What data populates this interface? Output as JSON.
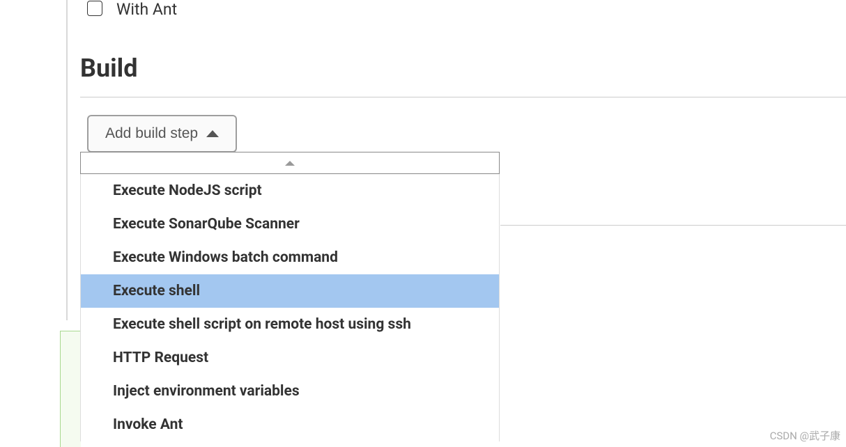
{
  "withAnt": {
    "label": "With Ant",
    "checked": false
  },
  "buildSection": {
    "title": "Build",
    "addBuildStepLabel": "Add build step"
  },
  "dropdown": {
    "items": [
      {
        "label": "Execute NodeJS script",
        "selected": false
      },
      {
        "label": "Execute SonarQube Scanner",
        "selected": false
      },
      {
        "label": "Execute Windows batch command",
        "selected": false
      },
      {
        "label": "Execute shell",
        "selected": true
      },
      {
        "label": "Execute shell script on remote host using ssh",
        "selected": false
      },
      {
        "label": "HTTP Request",
        "selected": false
      },
      {
        "label": "Inject environment variables",
        "selected": false
      },
      {
        "label": "Invoke Ant",
        "selected": false
      }
    ]
  },
  "watermark": "CSDN @武子康"
}
